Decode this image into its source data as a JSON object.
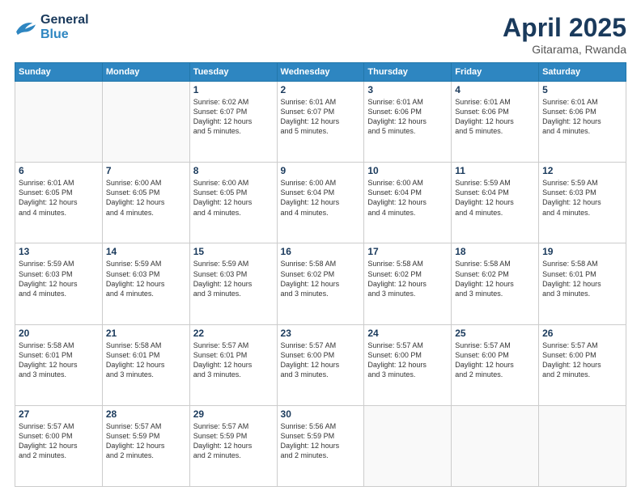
{
  "header": {
    "logo_line1": "General",
    "logo_line2": "Blue",
    "month": "April 2025",
    "location": "Gitarama, Rwanda"
  },
  "weekdays": [
    "Sunday",
    "Monday",
    "Tuesday",
    "Wednesday",
    "Thursday",
    "Friday",
    "Saturday"
  ],
  "weeks": [
    [
      {
        "day": "",
        "text": ""
      },
      {
        "day": "",
        "text": ""
      },
      {
        "day": "1",
        "text": "Sunrise: 6:02 AM\nSunset: 6:07 PM\nDaylight: 12 hours\nand 5 minutes."
      },
      {
        "day": "2",
        "text": "Sunrise: 6:01 AM\nSunset: 6:07 PM\nDaylight: 12 hours\nand 5 minutes."
      },
      {
        "day": "3",
        "text": "Sunrise: 6:01 AM\nSunset: 6:06 PM\nDaylight: 12 hours\nand 5 minutes."
      },
      {
        "day": "4",
        "text": "Sunrise: 6:01 AM\nSunset: 6:06 PM\nDaylight: 12 hours\nand 5 minutes."
      },
      {
        "day": "5",
        "text": "Sunrise: 6:01 AM\nSunset: 6:06 PM\nDaylight: 12 hours\nand 4 minutes."
      }
    ],
    [
      {
        "day": "6",
        "text": "Sunrise: 6:01 AM\nSunset: 6:05 PM\nDaylight: 12 hours\nand 4 minutes."
      },
      {
        "day": "7",
        "text": "Sunrise: 6:00 AM\nSunset: 6:05 PM\nDaylight: 12 hours\nand 4 minutes."
      },
      {
        "day": "8",
        "text": "Sunrise: 6:00 AM\nSunset: 6:05 PM\nDaylight: 12 hours\nand 4 minutes."
      },
      {
        "day": "9",
        "text": "Sunrise: 6:00 AM\nSunset: 6:04 PM\nDaylight: 12 hours\nand 4 minutes."
      },
      {
        "day": "10",
        "text": "Sunrise: 6:00 AM\nSunset: 6:04 PM\nDaylight: 12 hours\nand 4 minutes."
      },
      {
        "day": "11",
        "text": "Sunrise: 5:59 AM\nSunset: 6:04 PM\nDaylight: 12 hours\nand 4 minutes."
      },
      {
        "day": "12",
        "text": "Sunrise: 5:59 AM\nSunset: 6:03 PM\nDaylight: 12 hours\nand 4 minutes."
      }
    ],
    [
      {
        "day": "13",
        "text": "Sunrise: 5:59 AM\nSunset: 6:03 PM\nDaylight: 12 hours\nand 4 minutes."
      },
      {
        "day": "14",
        "text": "Sunrise: 5:59 AM\nSunset: 6:03 PM\nDaylight: 12 hours\nand 4 minutes."
      },
      {
        "day": "15",
        "text": "Sunrise: 5:59 AM\nSunset: 6:03 PM\nDaylight: 12 hours\nand 3 minutes."
      },
      {
        "day": "16",
        "text": "Sunrise: 5:58 AM\nSunset: 6:02 PM\nDaylight: 12 hours\nand 3 minutes."
      },
      {
        "day": "17",
        "text": "Sunrise: 5:58 AM\nSunset: 6:02 PM\nDaylight: 12 hours\nand 3 minutes."
      },
      {
        "day": "18",
        "text": "Sunrise: 5:58 AM\nSunset: 6:02 PM\nDaylight: 12 hours\nand 3 minutes."
      },
      {
        "day": "19",
        "text": "Sunrise: 5:58 AM\nSunset: 6:01 PM\nDaylight: 12 hours\nand 3 minutes."
      }
    ],
    [
      {
        "day": "20",
        "text": "Sunrise: 5:58 AM\nSunset: 6:01 PM\nDaylight: 12 hours\nand 3 minutes."
      },
      {
        "day": "21",
        "text": "Sunrise: 5:58 AM\nSunset: 6:01 PM\nDaylight: 12 hours\nand 3 minutes."
      },
      {
        "day": "22",
        "text": "Sunrise: 5:57 AM\nSunset: 6:01 PM\nDaylight: 12 hours\nand 3 minutes."
      },
      {
        "day": "23",
        "text": "Sunrise: 5:57 AM\nSunset: 6:00 PM\nDaylight: 12 hours\nand 3 minutes."
      },
      {
        "day": "24",
        "text": "Sunrise: 5:57 AM\nSunset: 6:00 PM\nDaylight: 12 hours\nand 3 minutes."
      },
      {
        "day": "25",
        "text": "Sunrise: 5:57 AM\nSunset: 6:00 PM\nDaylight: 12 hours\nand 2 minutes."
      },
      {
        "day": "26",
        "text": "Sunrise: 5:57 AM\nSunset: 6:00 PM\nDaylight: 12 hours\nand 2 minutes."
      }
    ],
    [
      {
        "day": "27",
        "text": "Sunrise: 5:57 AM\nSunset: 6:00 PM\nDaylight: 12 hours\nand 2 minutes."
      },
      {
        "day": "28",
        "text": "Sunrise: 5:57 AM\nSunset: 5:59 PM\nDaylight: 12 hours\nand 2 minutes."
      },
      {
        "day": "29",
        "text": "Sunrise: 5:57 AM\nSunset: 5:59 PM\nDaylight: 12 hours\nand 2 minutes."
      },
      {
        "day": "30",
        "text": "Sunrise: 5:56 AM\nSunset: 5:59 PM\nDaylight: 12 hours\nand 2 minutes."
      },
      {
        "day": "",
        "text": ""
      },
      {
        "day": "",
        "text": ""
      },
      {
        "day": "",
        "text": ""
      }
    ]
  ]
}
